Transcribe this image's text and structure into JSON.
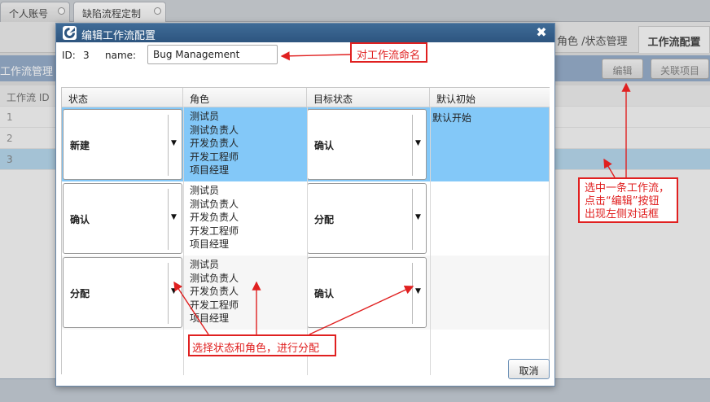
{
  "top_tabs": [
    "个人账号",
    "缺陷流程定制"
  ],
  "sub_tabs": [
    "角色 /状态管理",
    "工作流配置"
  ],
  "panel": {
    "title": "工作流管理",
    "edit_label": "编辑",
    "link_label": "关联项目",
    "table_header": "工作流 ID",
    "rows": [
      "1",
      "2",
      "3"
    ]
  },
  "dialog": {
    "title": "编辑工作流配置",
    "close_glyph": "✖",
    "id_label": "ID:",
    "id_value": "3",
    "name_label": "name:",
    "name_value": "Bug Management",
    "columns": [
      "状态",
      "角色",
      "目标状态",
      "默认初始"
    ],
    "rows": [
      {
        "state": "新建",
        "roles": [
          "测试员",
          "测试负责人",
          "开发负责人",
          "开发工程师",
          "项目经理"
        ],
        "target": "确认",
        "default": "默认开始",
        "selected": true
      },
      {
        "state": "确认",
        "roles": [
          "测试员",
          "测试负责人",
          "开发负责人",
          "开发工程师",
          "项目经理"
        ],
        "target": "分配",
        "default": "",
        "selected": false
      },
      {
        "state": "分配",
        "roles": [
          "测试员",
          "测试负责人",
          "开发负责人",
          "开发工程师",
          "项目经理"
        ],
        "target": "确认",
        "default": "",
        "selected": false
      }
    ],
    "cancel_label": "取消"
  },
  "annotations": {
    "name_note": "对工作流命名",
    "select_note": [
      "选中一条工作流，",
      "点击“编辑”按钮",
      "出现左侧对话框"
    ],
    "assign_note": "选择状态和角色，进行分配"
  },
  "colors": {
    "selected_row": "#83c8f8",
    "annotation": "#e02020",
    "dialog_title_bar": "#36618c"
  }
}
